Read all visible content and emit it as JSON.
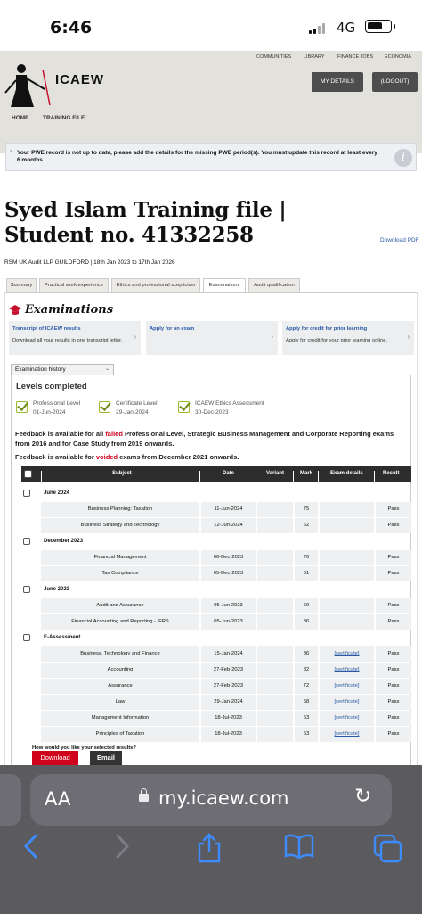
{
  "status_bar": {
    "time": "6:46",
    "network": "4G"
  },
  "site": {
    "top_links": [
      "COMMUNITIES",
      "LIBRARY",
      "FINANCE JOBS",
      "ECONOMIA"
    ],
    "logo": "ICAEW",
    "my_details": "MY DETAILS",
    "logout": "(LOGOUT)",
    "subnav": [
      "HOME",
      "TRAINING FILE"
    ]
  },
  "alert": {
    "text": "Your PWE record is not up to date, please add the details for the missing PWE period(s). You must update this record at least every 6 months."
  },
  "page": {
    "title": "Syed Islam Training file | Student no. 41332258",
    "download_pdf": "Download PDF",
    "subtitle": "RSM UK Audit LLP GUILDFORD | 18th Jan 2023 to 17th Jan 2026"
  },
  "tabs": [
    "Summary",
    "Practical work experience",
    "Ethics and professional scepticism",
    "Examinations",
    "Audit qualification"
  ],
  "section": {
    "heading": "Examinations"
  },
  "cards": [
    {
      "title": "Transcript of ICAEW results",
      "desc": "Download all your results in one transcript letter."
    },
    {
      "title": "Apply for an exam",
      "desc": ""
    },
    {
      "title": "Apply for credit for prior learning",
      "desc": "Apply for credit for your prior learning online."
    }
  ],
  "history": {
    "dropdown": "Examination history",
    "levels_heading": "Levels completed",
    "levels": [
      {
        "name": "Professional Level",
        "date": "01-Jun-2024"
      },
      {
        "name": "Certificate Level",
        "date": "29-Jan-2024"
      },
      {
        "name": "ICAEW Ethics Assessment",
        "date": "30-Dec-2023"
      }
    ],
    "fb1_a": "Feedback is available for all ",
    "fb1_b": "failed",
    "fb1_c": " Professional Level, Strategic Business Management and Corporate Reporting exams from 2016 and for Case Study from 2019 onwards.",
    "fb2_a": "Feedback is available for ",
    "fb2_b": "voided",
    "fb2_c": " exams from December 2021 onwards."
  },
  "table": {
    "headers": [
      "Subject",
      "Date",
      "Variant",
      "Mark",
      "Exam details",
      "Result"
    ],
    "groups": [
      {
        "name": "June 2024",
        "rows": [
          {
            "subject": "Business Planning: Taxation",
            "date": "11-Jun-2024",
            "variant": "",
            "mark": "75",
            "details": "",
            "result": "Pass"
          },
          {
            "subject": "Business Strategy and Technology",
            "date": "12-Jun-2024",
            "variant": "",
            "mark": "62",
            "details": "",
            "result": "Pass"
          }
        ]
      },
      {
        "name": "December 2023",
        "rows": [
          {
            "subject": "Financial Management",
            "date": "06-Dec-2023",
            "variant": "",
            "mark": "70",
            "details": "",
            "result": "Pass"
          },
          {
            "subject": "Tax Compliance",
            "date": "05-Dec-2023",
            "variant": "",
            "mark": "61",
            "details": "",
            "result": "Pass"
          }
        ]
      },
      {
        "name": "June 2023",
        "rows": [
          {
            "subject": "Audit and Assurance",
            "date": "05-Jun-2023",
            "variant": "",
            "mark": "69",
            "details": "",
            "result": "Pass"
          },
          {
            "subject": "Financial Accounting and Reporting - IFRS",
            "date": "05-Jun-2023",
            "variant": "",
            "mark": "86",
            "details": "",
            "result": "Pass"
          }
        ]
      },
      {
        "name": "E-Assessment",
        "rows": [
          {
            "subject": "Business, Technology and Finance",
            "date": "15-Jan-2024",
            "variant": "",
            "mark": "86",
            "details": "[certificate]",
            "result": "Pass"
          },
          {
            "subject": "Accounting",
            "date": "27-Feb-2023",
            "variant": "",
            "mark": "82",
            "details": "[certificate]",
            "result": "Pass"
          },
          {
            "subject": "Assurance",
            "date": "27-Feb-2023",
            "variant": "",
            "mark": "72",
            "details": "[certificate]",
            "result": "Pass"
          },
          {
            "subject": "Law",
            "date": "29-Jan-2024",
            "variant": "",
            "mark": "58",
            "details": "[certificate]",
            "result": "Pass"
          },
          {
            "subject": "Management Information",
            "date": "18-Jul-2023",
            "variant": "",
            "mark": "63",
            "details": "[certificate]",
            "result": "Pass"
          },
          {
            "subject": "Principles of Taxation",
            "date": "18-Jul-2023",
            "variant": "",
            "mark": "63",
            "details": "[certificate]",
            "result": "Pass"
          }
        ]
      }
    ]
  },
  "actions": {
    "question": "How would you like your selected results?",
    "download": "Download",
    "email": "Email"
  },
  "browser": {
    "aa": "AA",
    "url": "my.icaew.com"
  }
}
